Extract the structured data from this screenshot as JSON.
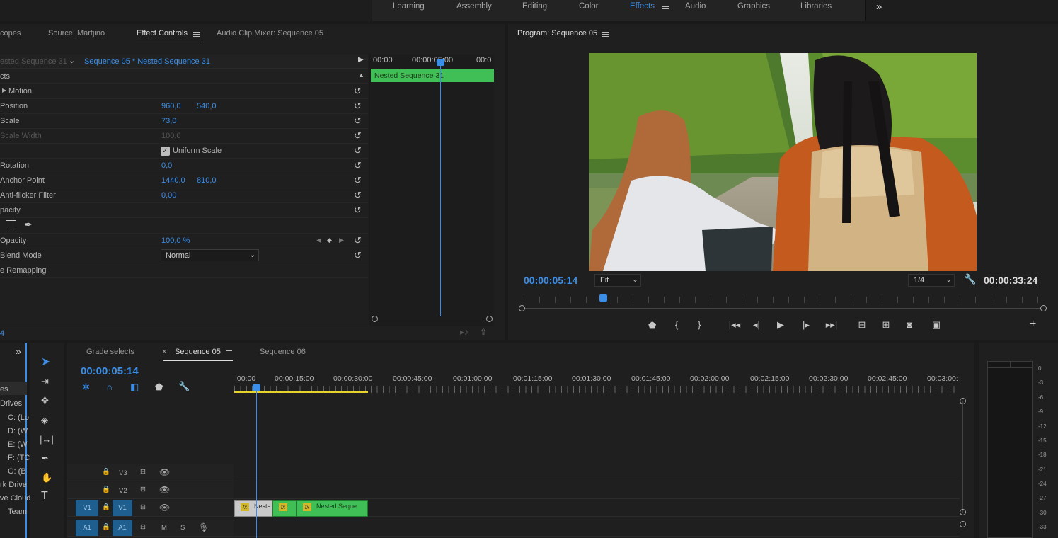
{
  "workspaces": {
    "items": [
      {
        "label": "Learning",
        "active": false
      },
      {
        "label": "Assembly",
        "active": false
      },
      {
        "label": "Editing",
        "active": false
      },
      {
        "label": "Color",
        "active": false
      },
      {
        "label": "Effects",
        "active": true
      },
      {
        "label": "Audio",
        "active": false
      },
      {
        "label": "Graphics",
        "active": false
      },
      {
        "label": "Libraries",
        "active": false
      }
    ],
    "more_glyph": "»"
  },
  "source_panel": {
    "tabs": [
      "copes",
      "Source: Martjino",
      "Effect Controls",
      "Audio Clip Mixer: Sequence 05"
    ],
    "active_tab": "Effect Controls",
    "master_label": "ested Sequence 31",
    "sequence_label": "Sequence 05 * Nested Sequence 31",
    "fx_header": "cts",
    "timecode_bottom": "4",
    "rows": {
      "motion": "Motion",
      "position": {
        "label": "Position",
        "x": "960,0",
        "y": "540,0"
      },
      "scale": {
        "label": "Scale",
        "value": "73,0"
      },
      "scale_width": {
        "label": "Scale Width",
        "value": "100,0"
      },
      "uniform": {
        "label": "Uniform Scale"
      },
      "rotation": {
        "label": "Rotation",
        "value": "0,0"
      },
      "anchor": {
        "label": "Anchor Point",
        "x": "1440,0",
        "y": "810,0"
      },
      "antiflicker": {
        "label": "Anti-flicker Filter",
        "value": "0,00"
      },
      "opacity_group": "pacity",
      "opacity": {
        "label": "Opacity",
        "value": "100,0 %"
      },
      "blend": {
        "label": "Blend Mode",
        "value": "Normal"
      },
      "remap": "e Remapping"
    },
    "mini_timeline": {
      "ruler": [
        ":00:00",
        "00:00:05:00",
        "00:0"
      ],
      "clip_label": "Nested Sequence 31"
    }
  },
  "program": {
    "title": "Program: Sequence 05",
    "timecode": "00:00:05:14",
    "fit": "Fit",
    "resolution": "1/4",
    "duration": "00:00:33:24"
  },
  "project": {
    "items": [
      "es",
      "Drives",
      "C: (Lo",
      "D: (W",
      "E: (W",
      "F: (TC",
      "G: (B",
      "rk Drive",
      "ve Cloud",
      "Team"
    ]
  },
  "timeline": {
    "tabs": [
      "Grade selects",
      "Sequence 05",
      "Sequence 06"
    ],
    "active_tab": "Sequence 05",
    "timecode": "00:00:05:14",
    "ruler": [
      ":00:00",
      "00:00:15:00",
      "00:00:30:00",
      "00:00:45:00",
      "00:01:00:00",
      "00:01:15:00",
      "00:01:30:00",
      "00:01:45:00",
      "00:02:00:00",
      "00:02:15:00",
      "00:02:30:00",
      "00:02:45:00",
      "00:03:00:"
    ],
    "tracks": {
      "v3": "V3",
      "v2": "V2",
      "v1_src": "V1",
      "v1": "V1",
      "a1_src": "A1",
      "a1": "A1",
      "m": "M",
      "s": "S"
    },
    "clips": [
      {
        "label": "Neste"
      },
      {
        "label": ""
      },
      {
        "label": "Nested Seque"
      }
    ]
  },
  "meter": {
    "labels": [
      "0",
      "-3",
      "-6",
      "-9",
      "-12",
      "-15",
      "-18",
      "-21",
      "-24",
      "-27",
      "-30",
      "-33"
    ]
  },
  "colors": {
    "accent": "#3b8ee8",
    "clip_green": "#3fbf55",
    "playhead": "#3b8ee8",
    "work_area": "#e6d32b"
  }
}
